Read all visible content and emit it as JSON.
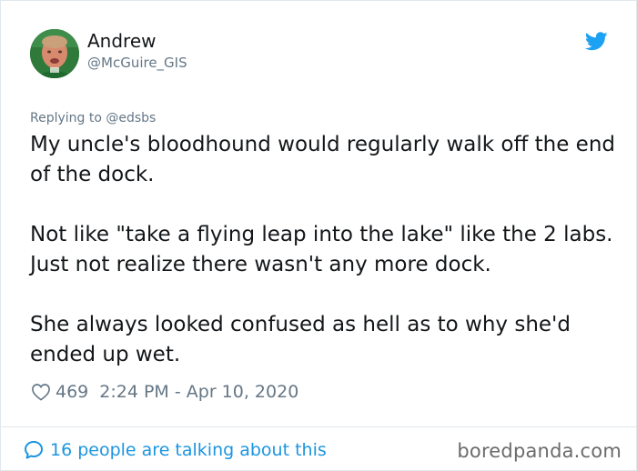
{
  "author": {
    "display_name": "Andrew",
    "handle": "@McGuire_GIS",
    "avatar_icon": "profile-photo"
  },
  "brand_icon": "twitter-bird-icon",
  "brand_color": "#1da1f2",
  "reply": {
    "text": "Replying to @edsbs"
  },
  "tweet": {
    "paragraphs": [
      "My uncle's bloodhound would regularly walk off the end of the dock.",
      "Not like \"take a flying leap into the lake\" like the 2 labs.  Just not realize there wasn't any more dock.",
      "She always looked confused as hell as to why she'd ended up wet."
    ]
  },
  "meta": {
    "likes": "469",
    "timestamp": "2:24 PM - Apr 10, 2020"
  },
  "footer": {
    "talking_text": "16 people are talking about this",
    "link_color": "#1b95e0"
  },
  "watermark": "boredpanda.com"
}
